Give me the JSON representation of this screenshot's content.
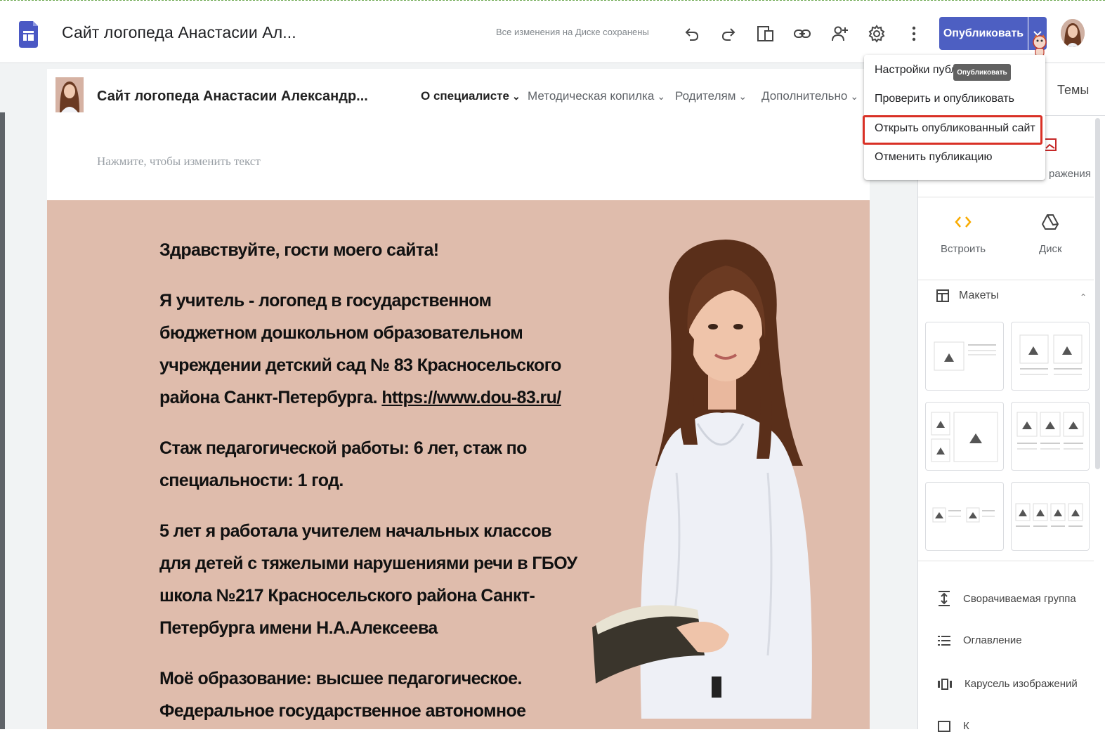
{
  "app": {
    "doc_title": "Сайт логопеда Анастасии Ал...",
    "saved_status": "Все изменения на Диске сохранены",
    "publish_label": "Опубликовать"
  },
  "toolbar_icons": [
    "undo-icon",
    "redo-icon",
    "preview-icon",
    "link-icon",
    "add-person-icon",
    "settings-icon",
    "more-vert-icon"
  ],
  "site": {
    "title": "Сайт логопеда Анастасии Александр...",
    "nav": [
      {
        "label": "О специалисте",
        "active": true
      },
      {
        "label": "Методическая копилка",
        "active": false
      },
      {
        "label": "Родителям",
        "active": false
      },
      {
        "label": "Дополнительно",
        "active": false
      }
    ],
    "edit_placeholder": "Нажмите, чтобы изменить текст"
  },
  "content": {
    "greeting": "Здравствуйте, гости моего сайта!",
    "para1": "Я учитель - логопед в государственном бюджетном дошкольном образовательном учреждении детский сад № 83 Красносельского района Санкт-Петербурга. ",
    "link": "https://www.dou-83.ru/",
    "para2": "Стаж педагогической работы: 6 лет, стаж по специальности: 1 год.",
    "para3": "5 лет я работала учителем начальных классов для детей с тяжелыми нарушениями речи в ГБОУ школа №217 Красносельского района Санкт-Петербурга имени Н.А.Алексеева",
    "para4": "Моё образование: высшее педагогическое. Федеральное государственное автономное"
  },
  "sidebar": {
    "themes": "Темы",
    "images_partial": "ражения",
    "embed": "Встроить",
    "drive": "Диск",
    "layouts": "Макеты",
    "items": [
      "Сворачиваемая группа",
      "Оглавление",
      "Карусель изображений",
      "К"
    ]
  },
  "menu": {
    "items": [
      "Настройки публи",
      "Проверить и опубликовать",
      "Открыть опубликованный сайт",
      "Отменить публикацию"
    ],
    "tooltip": "Опубликовать"
  },
  "colors": {
    "publish": "#4d5fc2",
    "content_bg": "#dfbcac",
    "highlight": "#d93025",
    "embed_icon": "#f9ab00"
  }
}
